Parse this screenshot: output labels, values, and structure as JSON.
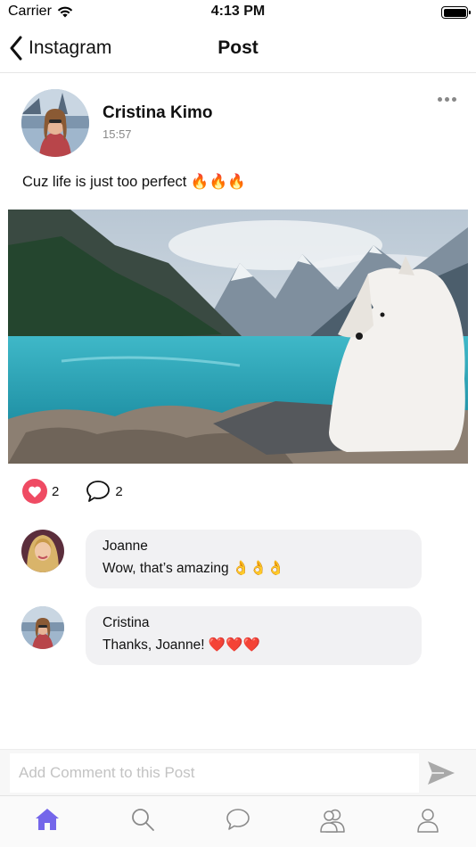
{
  "status_bar": {
    "carrier": "Carrier",
    "time": "4:13 PM"
  },
  "nav": {
    "back_label": "Instagram",
    "title": "Post"
  },
  "post": {
    "author": "Cristina Kimo",
    "time": "15:57",
    "caption": "Cuz life is just too perfect 🔥🔥🔥",
    "likes": "2",
    "comments_count": "2"
  },
  "comments": [
    {
      "author": "Joanne",
      "text": "Wow, that’s amazing 👌👌👌"
    },
    {
      "author": "Cristina",
      "text": "Thanks, Joanne! ❤️❤️❤️"
    }
  ],
  "composer": {
    "placeholder": "Add Comment to this Post"
  },
  "tabs": [
    {
      "icon": "home-icon",
      "active": true
    },
    {
      "icon": "search-icon",
      "active": false
    },
    {
      "icon": "chat-icon",
      "active": false
    },
    {
      "icon": "friends-icon",
      "active": false
    },
    {
      "icon": "profile-icon",
      "active": false
    }
  ],
  "colors": {
    "accent": "#7466ea",
    "like": "#ef4b63",
    "inactive_icon": "#8a8a8a"
  }
}
